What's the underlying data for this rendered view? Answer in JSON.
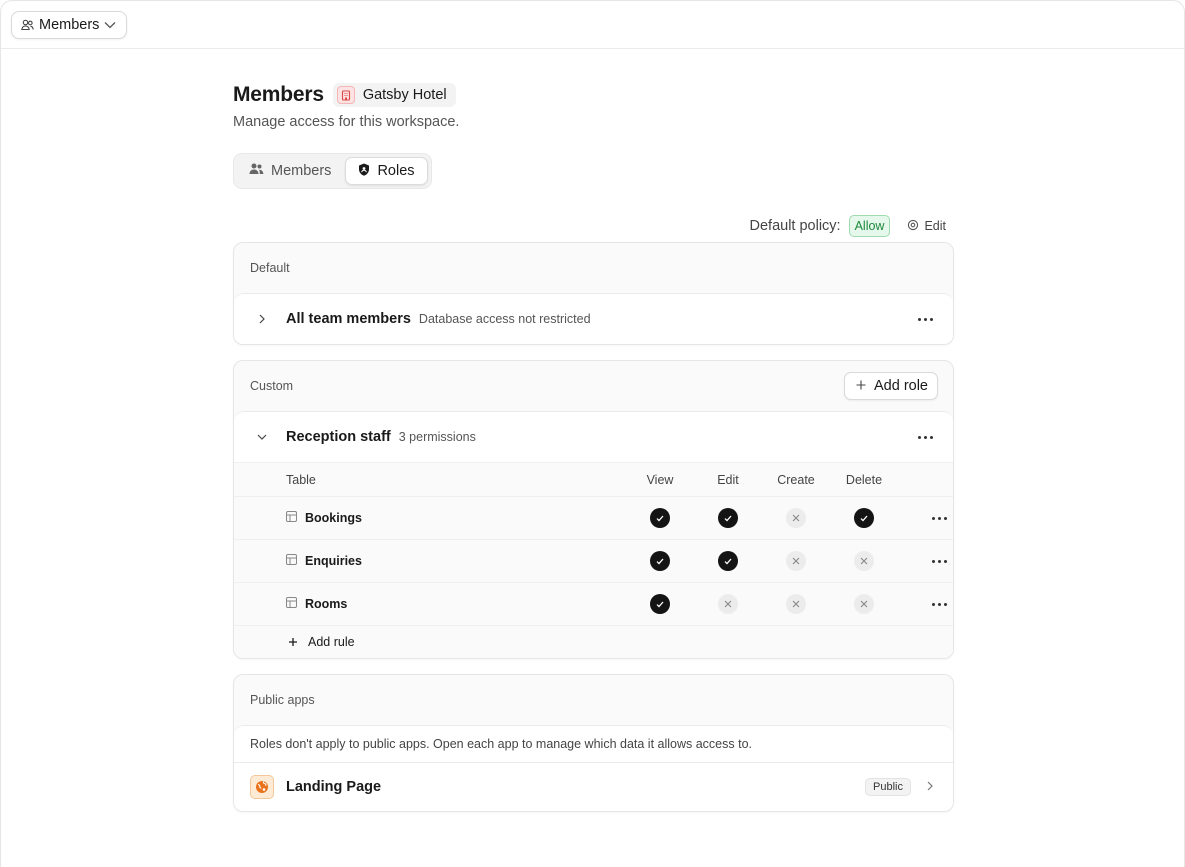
{
  "topbar": {
    "switcher_label": "Members"
  },
  "header": {
    "title": "Members",
    "workspace": "Gatsby Hotel",
    "subtitle": "Manage access for this workspace."
  },
  "tabs": [
    {
      "label": "Members",
      "active": false
    },
    {
      "label": "Roles",
      "active": true
    }
  ],
  "policy": {
    "label": "Default policy:",
    "value": "Allow",
    "edit_label": "Edit"
  },
  "default_section": {
    "heading": "Default",
    "role": {
      "name": "All team members",
      "description": "Database access not restricted"
    }
  },
  "custom_section": {
    "heading": "Custom",
    "add_role_label": "Add role",
    "role": {
      "name": "Reception staff",
      "description": "3 permissions",
      "columns": {
        "table": "Table",
        "view": "View",
        "edit": "Edit",
        "create": "Create",
        "delete": "Delete"
      },
      "rows": [
        {
          "table": "Bookings",
          "view": true,
          "edit": true,
          "create": false,
          "delete": true
        },
        {
          "table": "Enquiries",
          "view": true,
          "edit": true,
          "create": false,
          "delete": false
        },
        {
          "table": "Rooms",
          "view": true,
          "edit": false,
          "create": false,
          "delete": false
        }
      ],
      "add_rule_label": "Add rule"
    }
  },
  "public_section": {
    "heading": "Public apps",
    "notice": "Roles don't apply to public apps. Open each app to manage which data it allows access to.",
    "app": {
      "name": "Landing Page",
      "badge": "Public"
    }
  },
  "colors": {
    "allow_green": "#1d8a3e",
    "check_black": "#141414",
    "workspace_red": "#e04848",
    "app_orange": "#e8731c"
  }
}
